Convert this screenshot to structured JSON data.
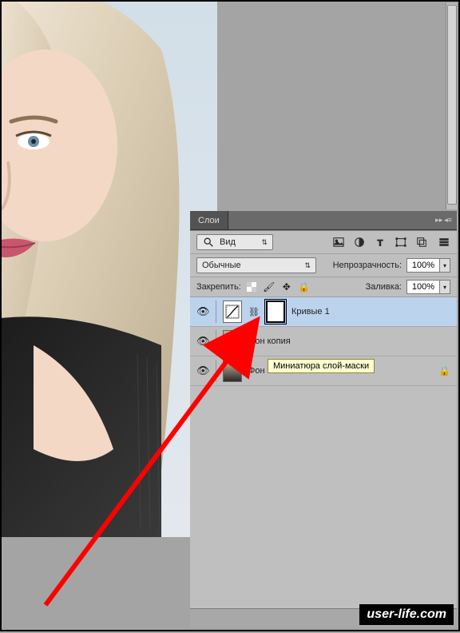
{
  "panel": {
    "title": "Слои",
    "filter": {
      "kind_label": "Вид"
    },
    "blend": {
      "mode": "Обычные",
      "opacity_label": "Непрозрачность:",
      "opacity_value": "100%"
    },
    "lock": {
      "label": "Закрепить:",
      "fill_label": "Заливка:",
      "fill_value": "100%"
    }
  },
  "layers": [
    {
      "name": "Кривые 1",
      "visible": true,
      "selected": true,
      "type": "adjustment-curves",
      "has_mask": true
    },
    {
      "name": "Фон копия",
      "visible": true,
      "selected": false,
      "type": "pixel",
      "locked": false
    },
    {
      "name": "Фон",
      "visible": true,
      "selected": false,
      "type": "pixel",
      "locked": true
    }
  ],
  "tooltip": "Миниатюра слой-маски",
  "watermark": "user-life.com",
  "icons": {
    "image": "image-icon",
    "adjust": "adjust-icon",
    "text": "text-icon",
    "shape": "shape-icon",
    "smart": "smart-icon",
    "menu": "menu-icon",
    "search": "search-icon",
    "link": "link-icon",
    "fx": "fx-icon"
  }
}
